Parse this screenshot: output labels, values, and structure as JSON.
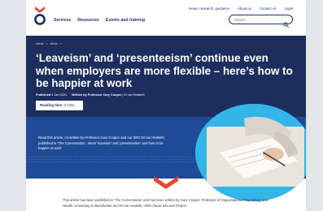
{
  "header": {
    "utility_links": [
      "News, research, guidance",
      "About us",
      "Contact us",
      "Login"
    ],
    "nav_items": [
      "Services",
      "Resources",
      "Events and training"
    ],
    "search_placeholder": "Search",
    "logo_icon": "stacked-chevrons-logo-icon",
    "search_icon": "magnifier-search-icon"
  },
  "breadcrumb": [
    "Home",
    ">",
    "News",
    ">"
  ],
  "hero": {
    "title": "‘Leaveism’ and ‘presenteeism’ continue even when employers are more flexible – here’s how to be happier at work",
    "published_label": "Published",
    "published_date": "4 Jan 2024",
    "written_label": "Written by Professor Cary Cooper",
    "coauthor": "Dr Ian Hesketh",
    "reading_label": "Reading time:",
    "reading_value": "3 mins"
  },
  "intro": {
    "text": "Read this article, co-written by Professor Cary Cooper and our SRO Dr Ian Hesketh, published in 'The Conversation', about 'leaveism' and 'presenteeism' and how to be happier at work",
    "image_icon": "person-writing-on-paper-photo"
  },
  "article": {
    "body": "This article has been published in 'The Conversation' and has been written by Cary Cooper, Professor of Organisational Psychology and Health, University of Manchester and Dr Ian Hesketh, SRO Oscar Kilo and Project"
  },
  "colors": {
    "navy": "#1d2d5e",
    "band_blue": "#1f4a96",
    "accent_orange": "#e8472e",
    "circle_blue": "#33b5ea"
  }
}
